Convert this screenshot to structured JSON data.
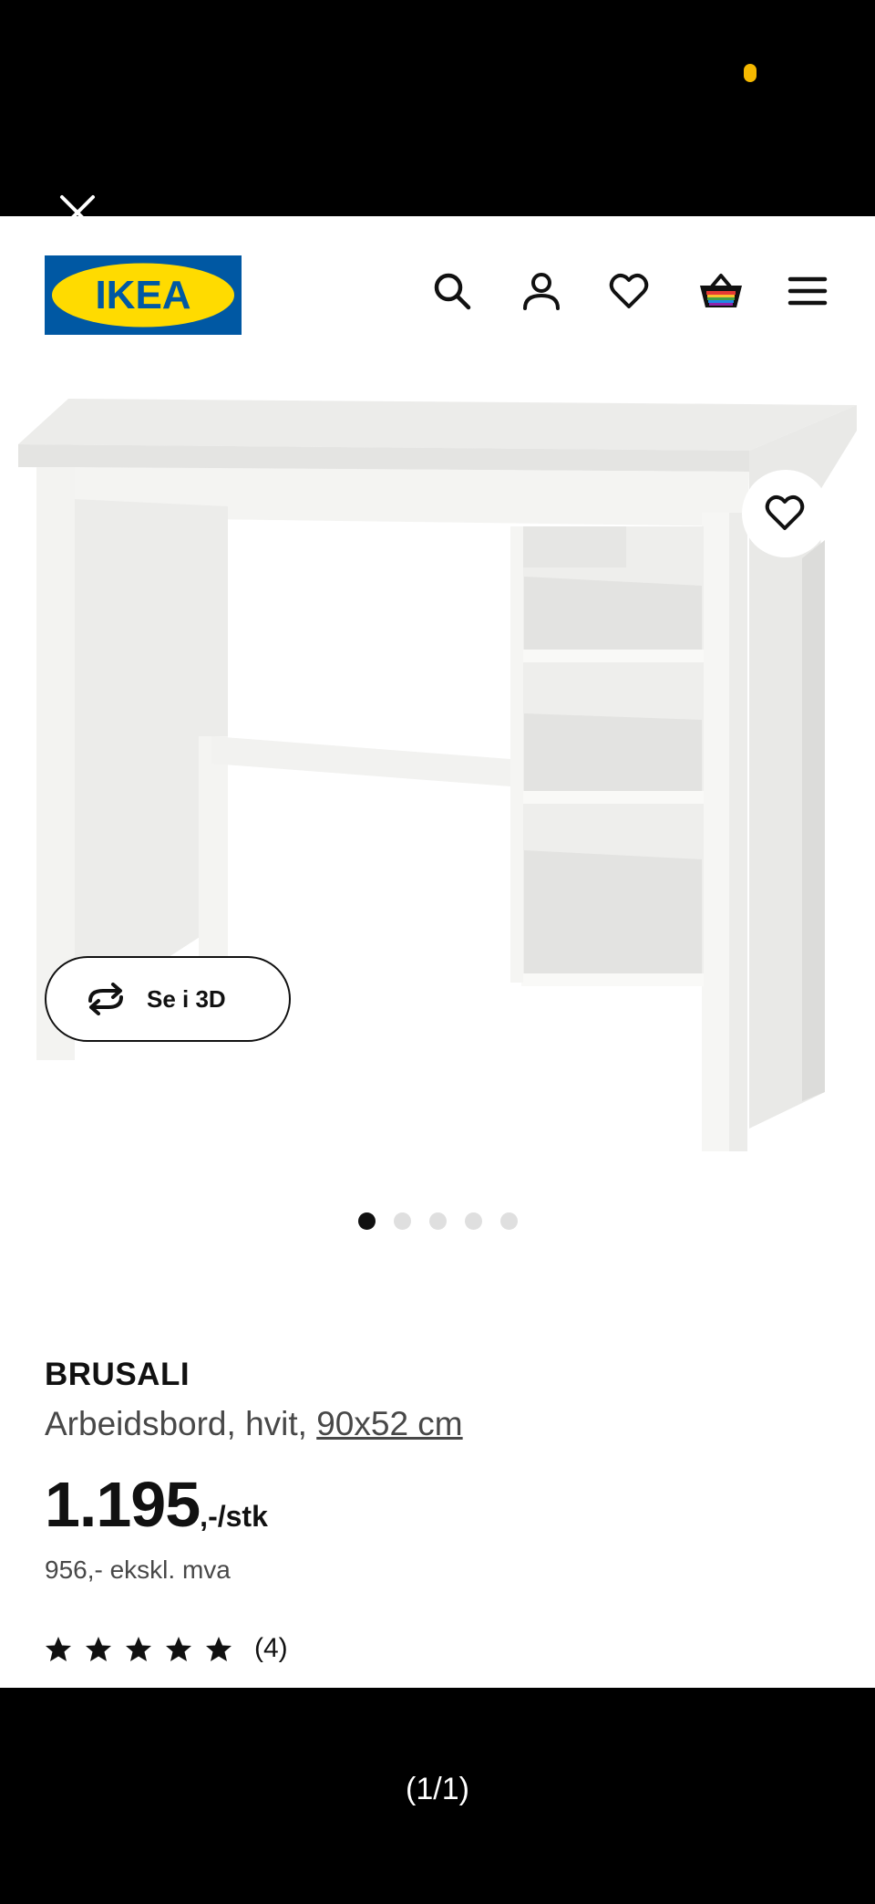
{
  "status_bar": {
    "indicator_color": "#f5b800"
  },
  "viewer": {
    "close_icon": "close-icon",
    "counter": "(1/1)"
  },
  "header": {
    "logo_text": "IKEA",
    "logo_colors": {
      "blue": "#0058a3",
      "yellow": "#ffdb00"
    },
    "icons": [
      "search-icon",
      "user-icon",
      "heart-icon",
      "basket-icon",
      "menu-icon"
    ]
  },
  "gallery": {
    "favorite_icon": "heart-icon",
    "view_3d_label": "Se i 3D",
    "view_3d_icon": "rotate-icon",
    "image_count": 5,
    "active_index": 0
  },
  "product": {
    "name": "BRUSALI",
    "description": "Arbeidsbord, hvit, ",
    "dimensions": "90x52 cm",
    "price_integer": "1.195",
    "price_suffix": ",-/stk",
    "price_excl_vat": "956,- ekskl. mva",
    "rating_stars": 5,
    "rating_count": "(4)"
  }
}
